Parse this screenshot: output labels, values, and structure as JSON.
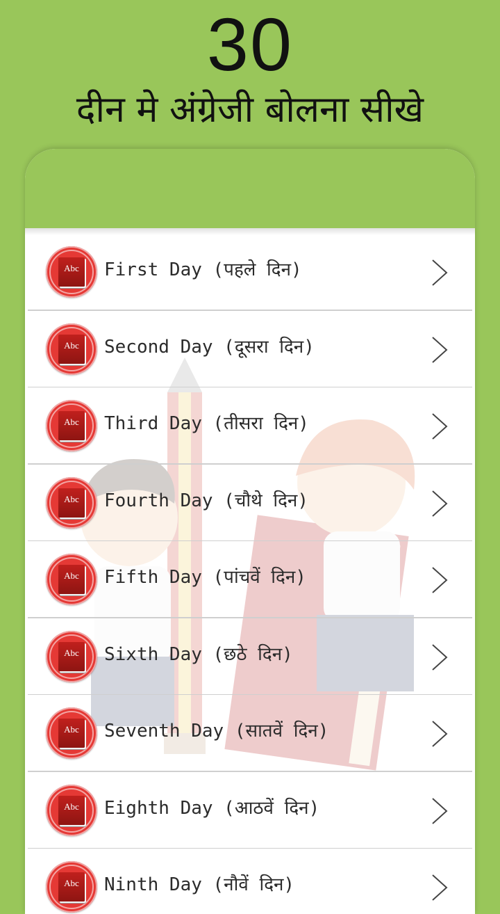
{
  "header": {
    "number": "30",
    "subtitle": "दीन मे अंग्रेजी बोलना सीखे"
  },
  "colors": {
    "background": "#99c65a",
    "card": "#ffffff",
    "badge": "#e53935",
    "chevron": "#444444"
  },
  "icons": {
    "badge": "abc-book-icon",
    "chevron": "chevron-right-icon"
  },
  "badge_text": "Abc",
  "days": [
    {
      "label": "First Day (पहले दिन)"
    },
    {
      "label": "Second Day (दूसरा दिन)"
    },
    {
      "label": "Third Day (तीसरा दिन)"
    },
    {
      "label": "Fourth Day (चौथे दिन)"
    },
    {
      "label": "Fifth Day (पांचवें दिन)"
    },
    {
      "label": "Sixth Day (छठे दिन)"
    },
    {
      "label": "Seventh Day (सातवें दिन)"
    },
    {
      "label": "Eighth Day (आठवें दिन)"
    },
    {
      "label": "Ninth Day (नौवें दिन)"
    }
  ]
}
